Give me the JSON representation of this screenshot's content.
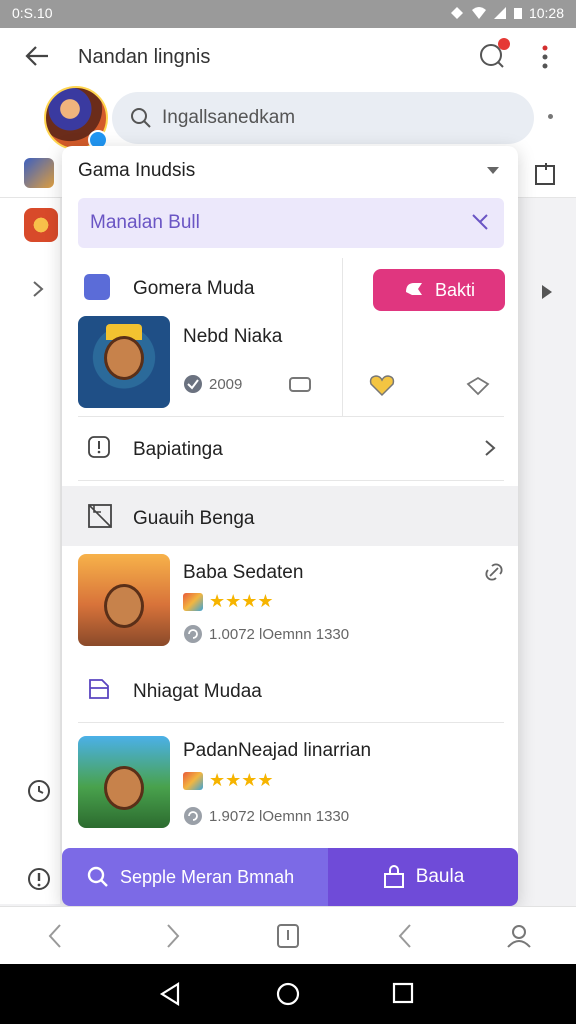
{
  "status_bar": {
    "time": "0:S.10",
    "right_time": "10:28"
  },
  "app_bar": {
    "title": "Nandan lingnis"
  },
  "search": {
    "placeholder": "Ingallsanedkam"
  },
  "panel": {
    "header": "Gama Inudsis",
    "chip_label": "Manalan Bull",
    "featured": {
      "section_label": "Gomera Muda",
      "game_title": "Nebd Niaka",
      "count": "2009",
      "action_button": "Bakti"
    },
    "row_label": "Bapiatinga",
    "section_two_label": "Guauih Benga",
    "list": [
      {
        "title": "Baba Sedaten",
        "meta": "1.0072 lOemnn 1330",
        "stars": "★★★★"
      },
      {
        "title": "PadanNeajad linarrian",
        "meta": "1.9072 lOemnn 1330",
        "stars": "★★★★"
      }
    ],
    "section_three_label": "Nhiagat Mudaa"
  },
  "action_bar": {
    "left_label": "Sepple Meran Bmnah",
    "right_label": "Baula"
  },
  "colors": {
    "accent_purple": "#6f4bd8",
    "pink": "#e0367f",
    "chip_bg": "#ece8fb"
  },
  "icons": [
    "back-arrow-icon",
    "chat-icon",
    "more-vert-icon",
    "search-icon",
    "chevron-down-icon",
    "close-icon",
    "game-badge-icon",
    "hand-icon",
    "check-icon",
    "controller-icon",
    "heart-icon",
    "diamond-icon",
    "info-icon",
    "chevron-right-icon",
    "image-icon",
    "link-icon",
    "bookmark-icon",
    "lock-icon",
    "bag-icon",
    "refresh-icon"
  ]
}
